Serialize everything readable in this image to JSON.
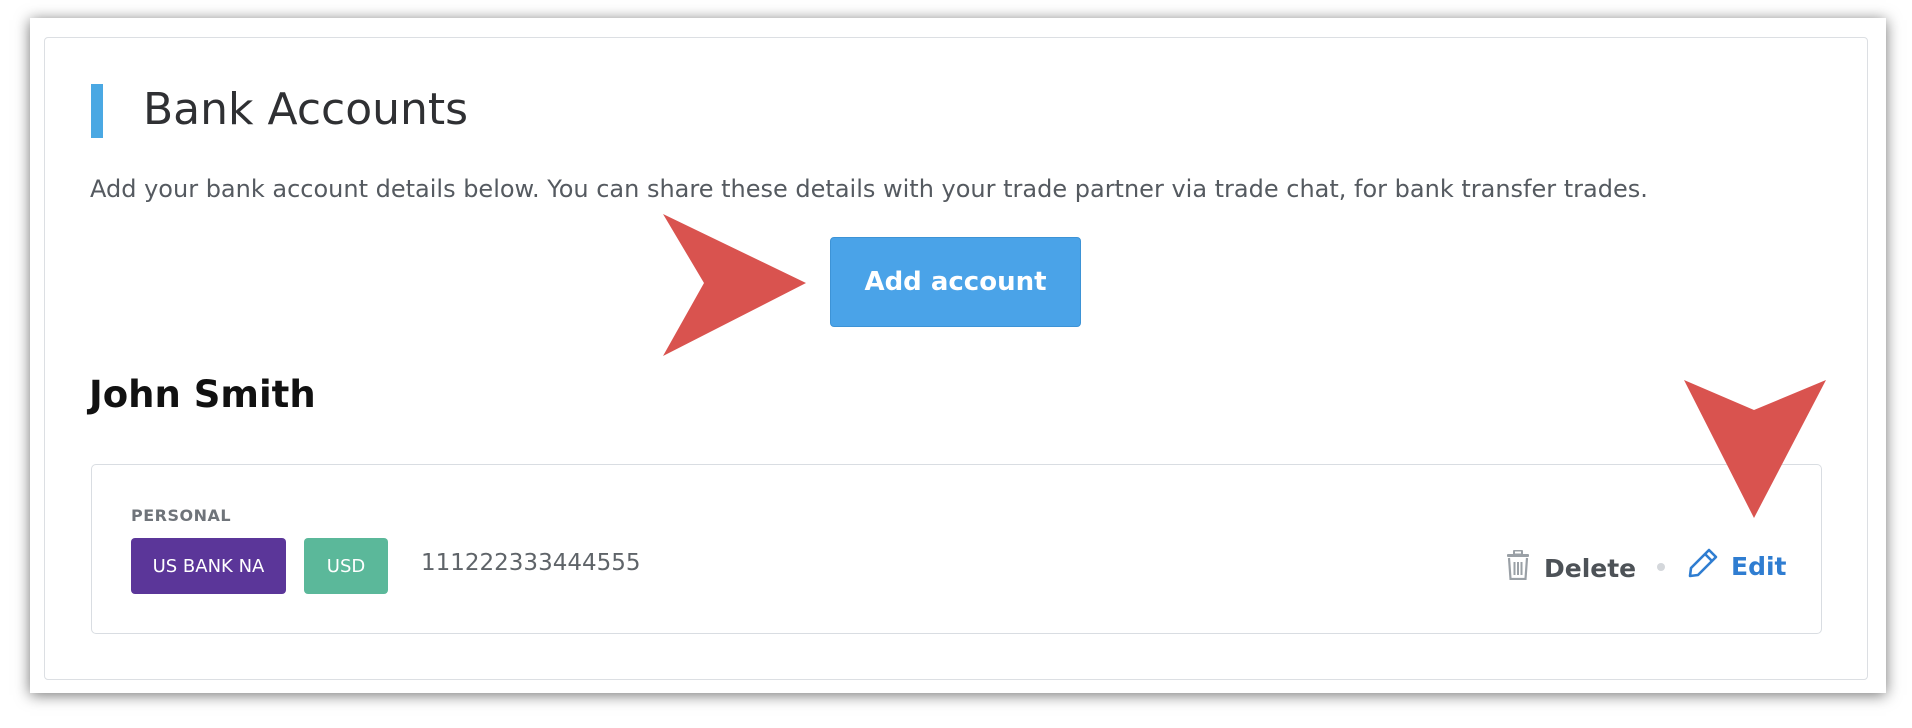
{
  "section": {
    "title": "Bank Accounts",
    "description": "Add your bank account details below. You can share these details with your trade partner via trade chat, for bank transfer trades.",
    "add_button_label": "Add account",
    "accent_color": "#4aa8e3"
  },
  "account_holder": {
    "name": "John Smith"
  },
  "accounts": [
    {
      "type_label": "PERSONAL",
      "bank_badge": "US BANK NA",
      "currency_badge": "USD",
      "account_number": "111222333444555",
      "delete_label": "Delete",
      "edit_label": "Edit",
      "bank_badge_color": "#5b3699",
      "currency_badge_color": "#5bb89a"
    }
  ],
  "annotations": {
    "arrow_color": "#d9534f"
  }
}
